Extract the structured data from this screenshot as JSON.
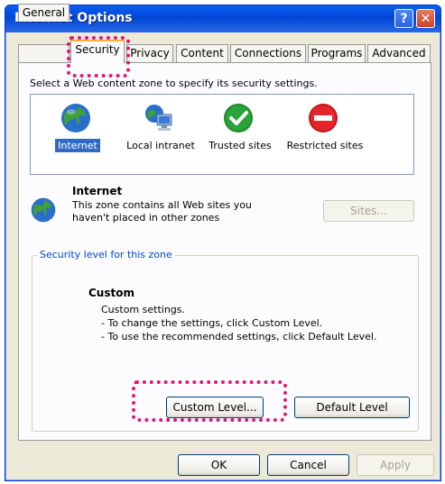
{
  "window": {
    "title": "Internet Options",
    "help_glyph": "?",
    "close_glyph": "✕"
  },
  "tabs": [
    {
      "label": "General"
    },
    {
      "label": "Security"
    },
    {
      "label": "Privacy"
    },
    {
      "label": "Content"
    },
    {
      "label": "Connections"
    },
    {
      "label": "Programs"
    },
    {
      "label": "Advanced"
    }
  ],
  "security": {
    "instruction": "Select a Web content zone to specify its security settings.",
    "zones": [
      {
        "label": "Internet",
        "icon": "globe-icon"
      },
      {
        "label": "Local intranet",
        "icon": "computer-network-icon"
      },
      {
        "label": "Trusted sites",
        "icon": "checkmark-icon"
      },
      {
        "label": "Restricted sites",
        "icon": "no-entry-icon"
      }
    ],
    "selected_zone": {
      "name": "Internet",
      "description_line1": "This zone contains all Web sites you",
      "description_line2": "haven't placed in other zones"
    },
    "sites_button": "Sites...",
    "group_title": "Security level for this zone",
    "level_name": "Custom",
    "level_line1": "Custom settings.",
    "level_line2": "- To change the settings, click Custom Level.",
    "level_line3": "- To use the recommended settings, click Default Level.",
    "custom_level_button": "Custom Level...",
    "default_level_button": "Default Level"
  },
  "footer": {
    "ok": "OK",
    "cancel": "Cancel",
    "apply": "Apply"
  },
  "colors": {
    "titlebar": "#0a4fd8",
    "highlight_dots": "#e0167a",
    "selection": "#316ac5"
  }
}
